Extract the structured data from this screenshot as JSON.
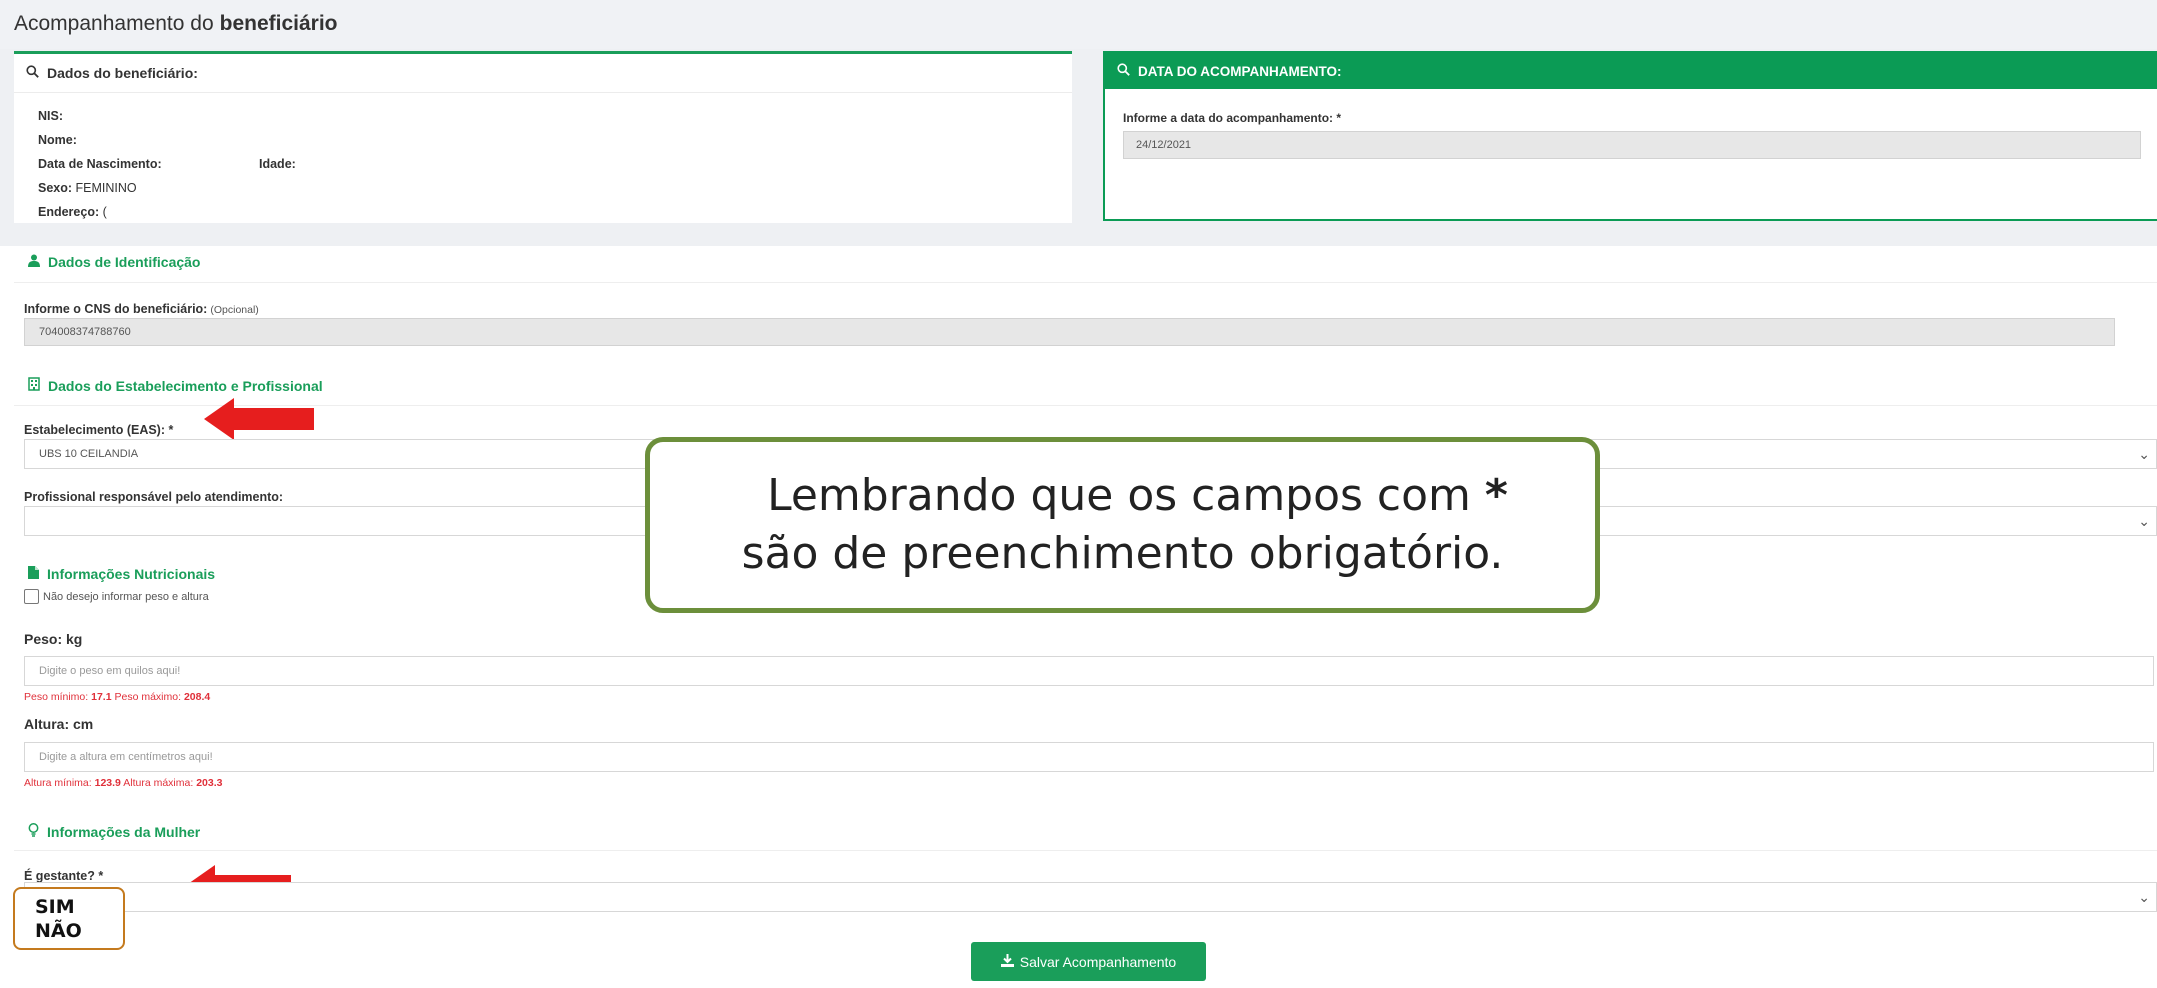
{
  "page": {
    "title_prefix": "Acompanhamento do",
    "title_bold": "beneficiário"
  },
  "beneficiary": {
    "header": "Dados do beneficiário:",
    "nis_label": "NIS:",
    "nome_label": "Nome:",
    "nascimento_label": "Data de Nascimento:",
    "idade_label": "Idade:",
    "sexo_label": "Sexo:",
    "sexo_value": "FEMININO",
    "endereco_label": "Endereço:",
    "endereco_value": "("
  },
  "date_card": {
    "header": "DATA DO ACOMPANHAMENTO:",
    "label": "Informe a data do acompanhamento: *",
    "value": "24/12/2021"
  },
  "identificacao": {
    "title": "Dados de Identificação",
    "cns_label": "Informe o CNS do beneficiário:",
    "cns_optional": "(Opcional)",
    "cns_value": "704008374788760"
  },
  "estabelecimento": {
    "title": "Dados do Estabelecimento e Profissional",
    "eas_label": "Estabelecimento (EAS): *",
    "eas_value": "UBS 10 CEILANDIA",
    "prof_label": "Profissional responsável pelo atendimento:",
    "prof_value": ""
  },
  "nutricionais": {
    "title": "Informações Nutricionais",
    "checkbox_label": "Não desejo informar peso e altura",
    "peso_label": "Peso: kg",
    "peso_placeholder": "Digite o peso em quilos aqui!",
    "peso_min_label": "Peso mínimo:",
    "peso_min": "17.1",
    "peso_max_label": "Peso máximo:",
    "peso_max": "208.4",
    "altura_label": "Altura: cm",
    "altura_placeholder": "Digite a altura em centímetros aqui!",
    "altura_min_label": "Altura mínima:",
    "altura_min": "123.9",
    "altura_max_label": "Altura máxima:",
    "altura_max": "203.3"
  },
  "mulher": {
    "title": "Informações da Mulher",
    "gestante_label": "É gestante? *",
    "gestante_value": ""
  },
  "callout": {
    "line1": "Lembrando que os campos com",
    "star": "*",
    "line2": "são de preenchimento obrigatório."
  },
  "options_annotation": {
    "opt1": "SIM",
    "opt2": "NÃO"
  },
  "actions": {
    "save_label": "Salvar Acompanhamento"
  },
  "colors": {
    "accent": "#1a9e5a",
    "header_green": "#0b9b55",
    "error": "#e0303a",
    "arrow": "#e61e1e",
    "callout_border": "#6c8f3b"
  }
}
